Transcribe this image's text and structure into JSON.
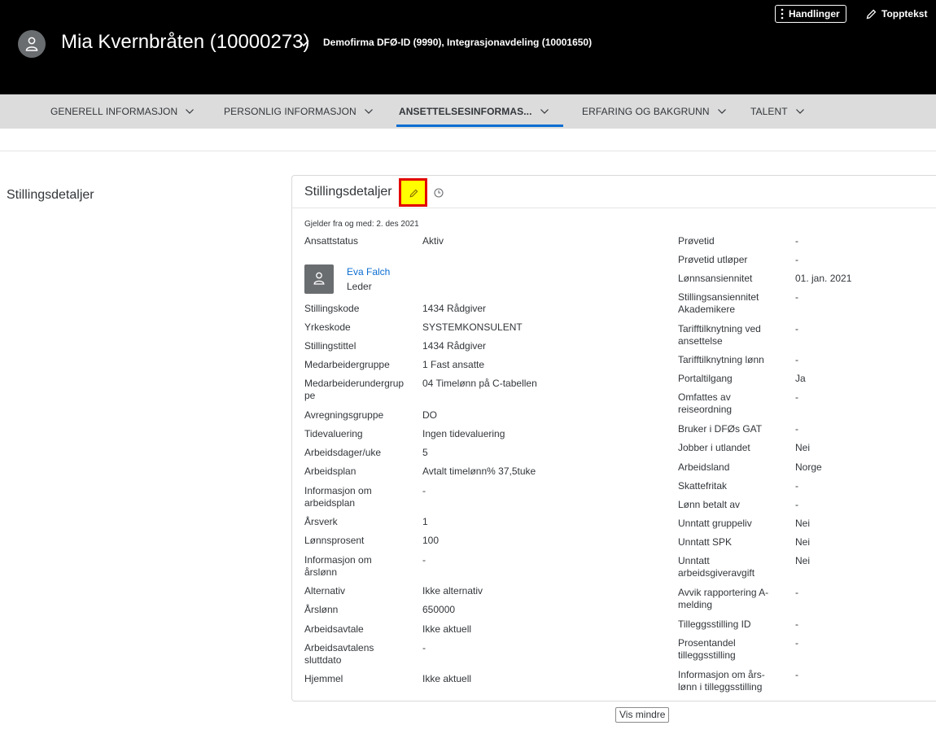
{
  "header": {
    "employee_name": "Mia Kvernbråten (10000273)",
    "organization": "Demofirma DFØ-ID (9990), Integrasjonavdeling (10001650)",
    "actions_label": "Handlinger",
    "header_text_label": "Topptekst"
  },
  "nav": {
    "tabs": [
      {
        "label": "GENERELL INFORMASJON"
      },
      {
        "label": "PERSONLIG INFORMASJON"
      },
      {
        "label": "ANSETTELSESINFORMAS..."
      },
      {
        "label": "ERFARING OG BAKGRUNN"
      },
      {
        "label": "TALENT"
      }
    ],
    "active_index": 2
  },
  "section": {
    "label": "Stillingsdetaljer"
  },
  "card": {
    "title": "Stillingsdetaljer",
    "effective_date": "Gjelder fra og med: 2. des 2021",
    "status_label": "Ansattstatus",
    "status_value": "Aktiv",
    "manager": {
      "name": "Eva Falch",
      "role": "Leder"
    },
    "left_fields": [
      {
        "label": "Stillingskode",
        "value": "1434 Rådgiver"
      },
      {
        "label": "Yrkeskode",
        "value": "SYSTEMKONSULENT"
      },
      {
        "label": "Stillingstittel",
        "value": "1434 Rådgiver"
      },
      {
        "label": "Medarbeidergruppe",
        "value": "1 Fast ansatte"
      },
      {
        "label": "Medarbeiderundergruppe",
        "value": "04 Timelønn på C-tabellen"
      },
      {
        "label": "Avregningsgruppe",
        "value": "DO"
      },
      {
        "label": "Tidevaluering",
        "value": "Ingen tidevaluering"
      },
      {
        "label": "Arbeidsdager/uke",
        "value": "5"
      },
      {
        "label": "Arbeidsplan",
        "value": "Avtalt timelønn% 37,5tuke"
      },
      {
        "label": "Informasjon om arbeidsplan",
        "value": "-"
      },
      {
        "label": "Årsverk",
        "value": "1"
      },
      {
        "label": "Lønnsprosent",
        "value": "100"
      },
      {
        "label": "Informasjon om årslønn",
        "value": "-"
      },
      {
        "label": "Alternativ",
        "value": "Ikke alternativ"
      },
      {
        "label": "Årslønn",
        "value": "650000"
      },
      {
        "label": "Arbeidsavtale",
        "value": "Ikke aktuell"
      },
      {
        "label": "Arbeidsavtalens sluttdato",
        "value": "-"
      },
      {
        "label": "Hjemmel",
        "value": "Ikke aktuell"
      }
    ],
    "right_fields": [
      {
        "label": "Prøvetid",
        "value": "-"
      },
      {
        "label": "Prøvetid utløper",
        "value": "-"
      },
      {
        "label": "Lønnsansiennitet",
        "value": "01. jan. 2021"
      },
      {
        "label": "Stillingsansiennitet Akademikere",
        "value": "-"
      },
      {
        "label": "Tarifftilknytning ved ansettelse",
        "value": "-"
      },
      {
        "label": "Tarifftilknytning lønn",
        "value": "-"
      },
      {
        "label": "Portaltilgang",
        "value": "Ja"
      },
      {
        "label": "Omfattes av reiseordning",
        "value": "-"
      },
      {
        "label": "Bruker i DFØs GAT",
        "value": "-"
      },
      {
        "label": "Jobber i utlandet",
        "value": "Nei"
      },
      {
        "label": "Arbeidsland",
        "value": "Norge"
      },
      {
        "label": "Skattefritak",
        "value": "-"
      },
      {
        "label": "Lønn betalt av",
        "value": "-"
      },
      {
        "label": "Unntatt gruppeliv",
        "value": "Nei"
      },
      {
        "label": "Unntatt SPK",
        "value": "Nei"
      },
      {
        "label": "Unntatt arbeidsgiveravgift",
        "value": "Nei"
      },
      {
        "label": "Avvik rapportering A-melding",
        "value": "-"
      },
      {
        "label": "Tilleggsstilling ID",
        "value": "-"
      },
      {
        "label": "Prosentandel tilleggsstilling",
        "value": "-"
      },
      {
        "label": "Informasjon om års-lønn i tilleggsstilling",
        "value": "-"
      }
    ],
    "show_less_label": "Vis mindre"
  },
  "colors": {
    "header_bg": "#000000",
    "nav_bg": "#dcdcdc",
    "accent": "#0a6ed1",
    "highlight_fill": "#ffff00",
    "highlight_border": "#e30000"
  },
  "icons": {
    "avatar": "person-icon",
    "header_chevron": "chevron-down-icon",
    "actions": "more-vertical-icon",
    "header_text": "pencil-icon",
    "edit": "pencil-icon",
    "history": "clock-icon"
  }
}
